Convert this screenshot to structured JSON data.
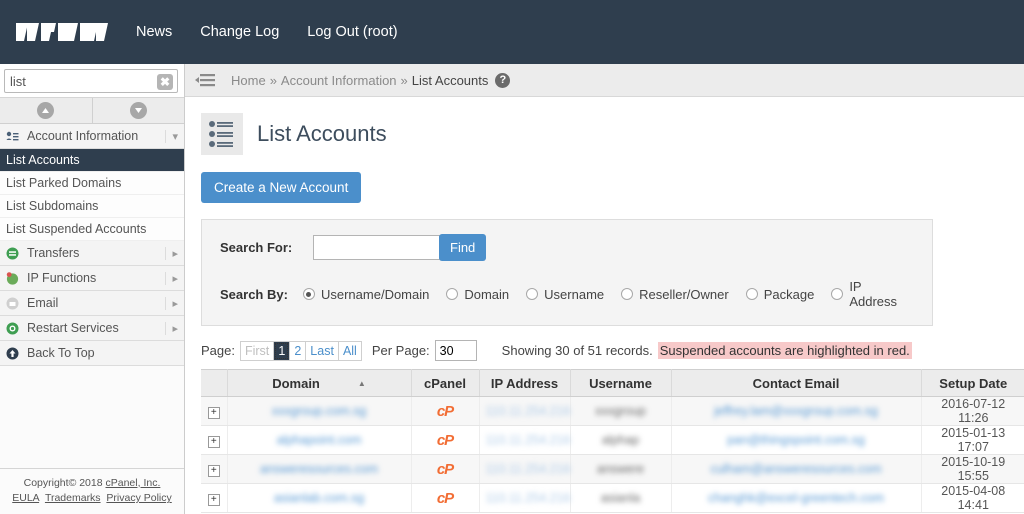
{
  "topbar": {
    "logo_text": "WHM",
    "logo_icon": "whm-logo",
    "nav": [
      {
        "label": "News"
      },
      {
        "label": "Change Log"
      },
      {
        "label": "Log Out (root)"
      }
    ]
  },
  "sidebar": {
    "search": {
      "value": "list",
      "placeholder": "",
      "clear_icon": "close-icon"
    },
    "collapse_icons": {
      "up": "chevron-up-icon",
      "down": "chevron-down-icon"
    },
    "groups": [
      {
        "label": "Account Information",
        "icon": "account-information-icon",
        "caret": "chevron-down-icon",
        "expanded": true,
        "items": [
          {
            "label": "List Accounts",
            "active": true
          },
          {
            "label": "List Parked Domains",
            "active": false
          },
          {
            "label": "List Subdomains",
            "active": false
          },
          {
            "label": "List Suspended Accounts",
            "active": false
          }
        ]
      }
    ],
    "collapsed_groups": [
      {
        "label": "Transfers",
        "icon": "transfers-icon",
        "caret": "chevron-right-icon"
      },
      {
        "label": "IP Functions",
        "icon": "ip-functions-icon",
        "caret": "chevron-right-icon"
      },
      {
        "label": "Email",
        "icon": "email-icon",
        "caret": "chevron-right-icon"
      },
      {
        "label": "Restart Services",
        "icon": "restart-services-icon",
        "caret": "chevron-right-icon"
      }
    ],
    "back_to_top": {
      "label": "Back To Top",
      "icon": "arrow-up-circle-icon"
    },
    "footer": {
      "copyright": "Copyright© 2018 ",
      "company": "cPanel, Inc.",
      "links": [
        {
          "label": "EULA"
        },
        {
          "label": "Trademarks"
        },
        {
          "label": "Privacy Policy"
        }
      ]
    }
  },
  "breadcrumb": {
    "menu_icon": "hamburger-menu-icon",
    "items": [
      {
        "label": "Home",
        "current": false
      },
      {
        "label": "Account Information",
        "current": false
      },
      {
        "label": "List Accounts",
        "current": true
      }
    ],
    "separator": "»",
    "help_icon": "question-mark-icon",
    "help_label": "?"
  },
  "page": {
    "title": "List Accounts",
    "title_icon": "list-accounts-icon",
    "create_button": "Create a New Account"
  },
  "search_panel": {
    "search_for_label": "Search For:",
    "search_for_value": "",
    "search_for_placeholder": "",
    "find_button": "Find",
    "search_by_label": "Search By:",
    "options": [
      {
        "label": "Username/Domain",
        "selected": true
      },
      {
        "label": "Domain",
        "selected": false
      },
      {
        "label": "Username",
        "selected": false
      },
      {
        "label": "Reseller/Owner",
        "selected": false
      },
      {
        "label": "Package",
        "selected": false
      },
      {
        "label": "IP Address",
        "selected": false
      }
    ]
  },
  "pagination": {
    "page_label": "Page:",
    "first": "First",
    "pages": [
      {
        "label": "1",
        "current": true
      },
      {
        "label": "2",
        "current": false
      }
    ],
    "last": "Last",
    "all": "All",
    "per_page_label": "Per Page:",
    "per_page_value": "30",
    "showing": "Showing 30 of 51 records.",
    "suspended_note": "Suspended accounts are highlighted in red.",
    "suspended_note_bg": "#f7c9c9"
  },
  "table": {
    "expand_icon": "plus-box-icon",
    "sort_icon": "sort-ascending-icon",
    "cpanel_icon": "cpanel-logo-icon",
    "columns": [
      {
        "label": "",
        "key": "expand"
      },
      {
        "label": "Domain",
        "key": "domain",
        "sorted": "asc"
      },
      {
        "label": "cPanel",
        "key": "cpanel"
      },
      {
        "label": "IP Address",
        "key": "ip"
      },
      {
        "label": "Username",
        "key": "username"
      },
      {
        "label": "Contact Email",
        "key": "email"
      },
      {
        "label": "Setup Date",
        "key": "setup_date"
      }
    ],
    "rows": [
      {
        "expand": "+",
        "domain": "xxxgroup.com.sg",
        "cpanel": "cP",
        "ip": "110.11.254.216",
        "username": "xxxgroup",
        "email": "jeffrey.lam@xxxgroup.com.sg",
        "setup_date": "2016-07-12 11:26",
        "redacted": true
      },
      {
        "expand": "+",
        "domain": "alphapoint.com",
        "cpanel": "cP",
        "ip": "110.11.254.216",
        "username": "alphap",
        "email": "pan@thingspoint.com.sg",
        "setup_date": "2015-01-13 17:07",
        "redacted": true
      },
      {
        "expand": "+",
        "domain": "answeresources.com",
        "cpanel": "cP",
        "ip": "110.11.254.216",
        "username": "answere",
        "email": "culham@answeresources.com",
        "setup_date": "2015-10-19 15:55",
        "redacted": true
      },
      {
        "expand": "+",
        "domain": "asianlab.com.sg",
        "cpanel": "cP",
        "ip": "110.11.254.216",
        "username": "asianla",
        "email": "changhk@excel-greentech.com",
        "setup_date": "2015-04-08 14:41",
        "redacted": true
      }
    ]
  },
  "colors": {
    "header_bg": "#2f3e4e",
    "accent_blue": "#4b8fcb",
    "cpanel_orange": "#f26d34",
    "suspended_red": "#f7c9c9",
    "sidebar_bg": "#fbfbfb"
  }
}
